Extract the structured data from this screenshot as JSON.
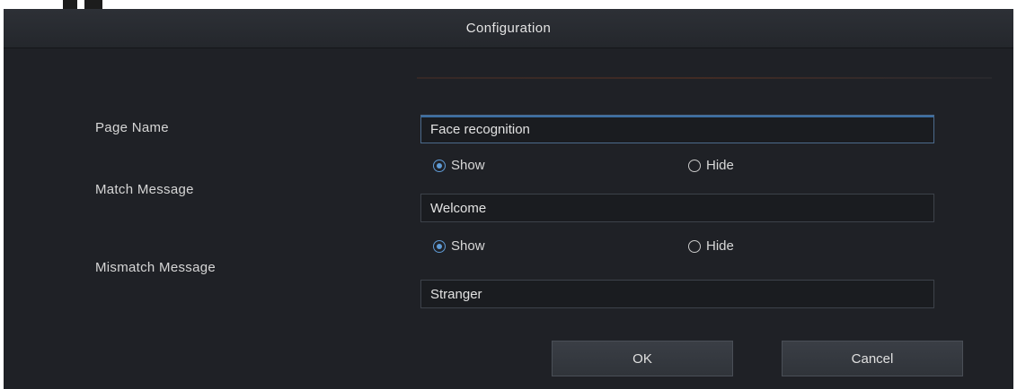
{
  "dialog": {
    "title": "Configuration"
  },
  "form": {
    "page_name": {
      "label": "Page Name",
      "value": "Face recognition"
    },
    "match_message": {
      "label": "Match Message",
      "options": [
        "Show",
        "Hide"
      ],
      "selected": "Show",
      "value": "Welcome"
    },
    "mismatch_message": {
      "label": "Mismatch Message",
      "options": [
        "Show",
        "Hide"
      ],
      "selected": "Show",
      "value": "Stranger"
    }
  },
  "buttons": {
    "ok": "OK",
    "cancel": "Cancel"
  },
  "colors": {
    "background": "#1f2126",
    "title_bar": "#2b2e34",
    "accent": "#5f9bd6",
    "text": "#d6d6d6"
  }
}
